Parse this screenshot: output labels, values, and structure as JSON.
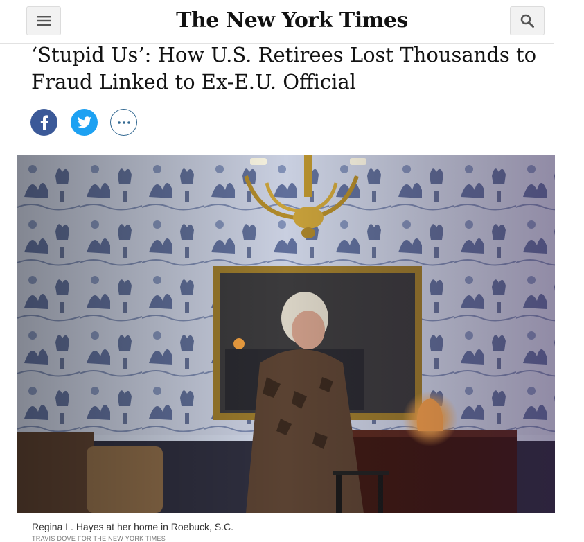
{
  "header": {
    "logo": "The New York Times",
    "menu_icon": "hamburger-menu-icon",
    "search_icon": "search-icon"
  },
  "article": {
    "headline": "‘Stupid Us’: How U.S. Retirees Lost Thousands to Fraud Linked to Ex-E.U. Official"
  },
  "share": {
    "facebook_icon": "facebook-icon",
    "twitter_icon": "twitter-icon",
    "more_icon": "more-options-icon",
    "colors": {
      "facebook": "#3b5998",
      "twitter": "#1da1f2",
      "more_border": "#326891"
    }
  },
  "photo": {
    "caption": "Regina L. Hayes at her home in Roebuck, S.C.",
    "credit": "TRAVIS DOVE FOR THE NEW YORK TIMES"
  }
}
